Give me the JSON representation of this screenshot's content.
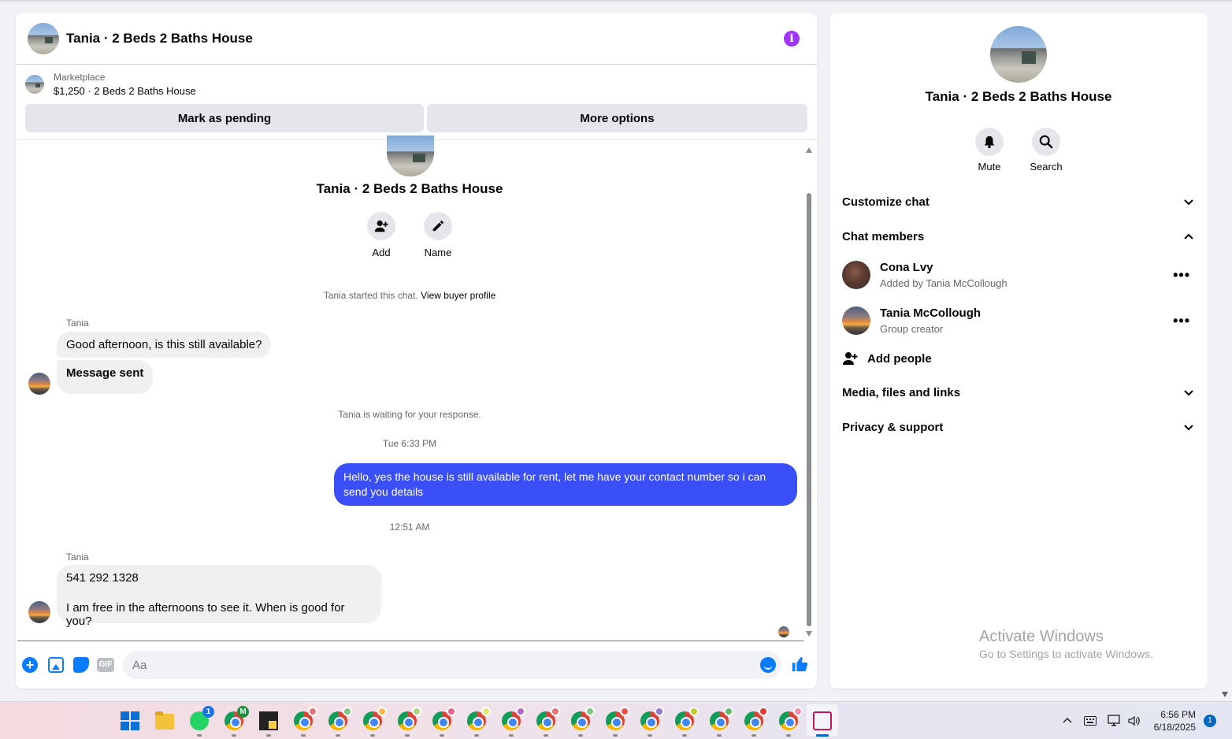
{
  "chat": {
    "title": "Tania · 2 Beds 2 Baths House",
    "marketplace_label": "Marketplace",
    "listing_title": "$1,250 · 2 Beds 2 Baths House",
    "mark_pending_label": "Mark as pending",
    "more_options_label": "More options",
    "group_name": "Tania · 2 Beds 2 Baths House",
    "add_label": "Add",
    "name_label": "Name",
    "started_text": "Tania started this chat.",
    "view_buyer_profile": "View buyer profile",
    "waiting_text": "Tania is waiting for your response.",
    "messages": [
      {
        "sender": "Tania",
        "text": "Good afternoon, is this still available?"
      },
      {
        "text": "Message sent"
      },
      {
        "timestamp": "Tue 6:33 PM"
      },
      {
        "text": "Hello, yes the house is still available for rent, let me have your contact number so i can send you  details"
      },
      {
        "timestamp": "12:51 AM"
      },
      {
        "sender": "Tania",
        "line1": "541 292 1328",
        "line2": "I am free in the afternoons to see it. When is good for you?"
      }
    ],
    "composer_placeholder": "Aa",
    "gif_label": "GIF",
    "accent_color": "#0a7cff",
    "outgoing_bubble_color": "#3a4ff7"
  },
  "info_panel": {
    "name": "Tania · 2 Beds 2 Baths House",
    "mute_label": "Mute",
    "search_label": "Search",
    "customize_chat": "Customize chat",
    "chat_members": "Chat members",
    "members": [
      {
        "name": "Cona Lvy",
        "subtitle": "Added by Tania McCollough"
      },
      {
        "name": "Tania McCollough",
        "subtitle": "Group creator"
      }
    ],
    "add_people": "Add people",
    "media_files_links": "Media, files and links",
    "privacy_support": "Privacy & support"
  },
  "watermark": {
    "line1": "Activate Windows",
    "line2": "Go to Settings to activate Windows."
  },
  "taskbar": {
    "whatsapp_badge": "1",
    "chrome_badge_letter": "M",
    "time": "6:56 PM",
    "date": "6/18/2025",
    "notification_count": "1"
  }
}
